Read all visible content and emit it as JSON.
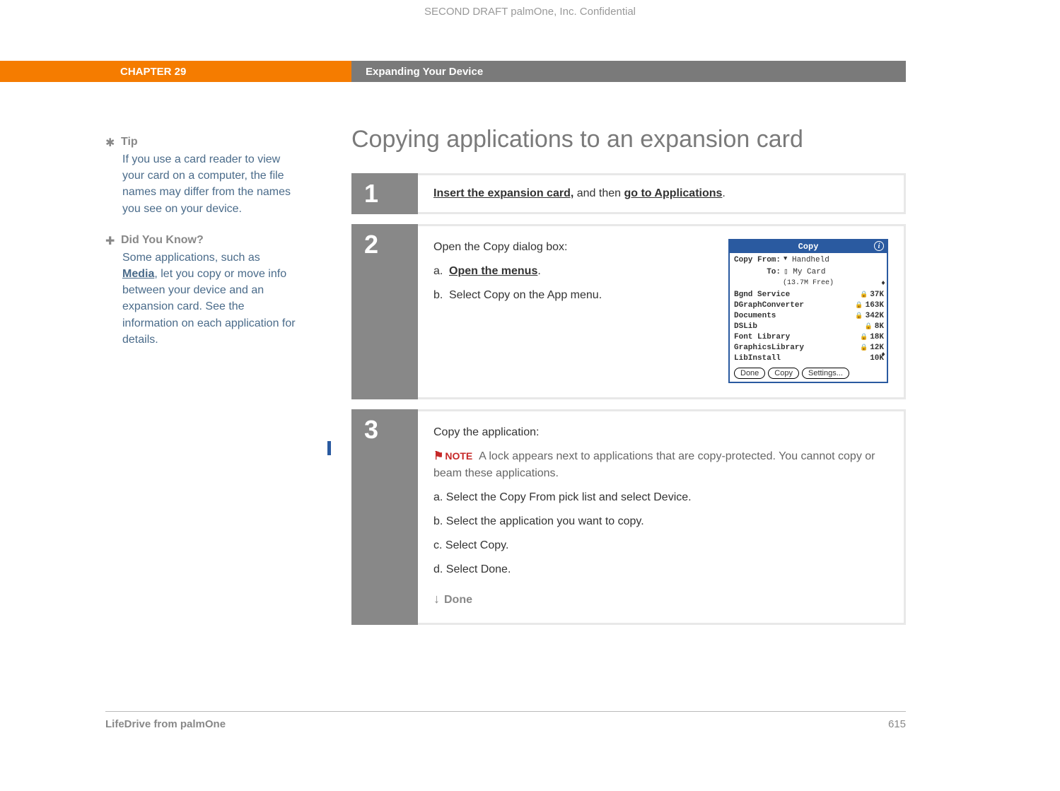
{
  "header": {
    "confidential": "SECOND DRAFT palmOne, Inc.  Confidential",
    "chapter": "CHAPTER 29",
    "chapter_title": "Expanding Your Device"
  },
  "sidebar": {
    "tip": {
      "label": "Tip",
      "body": "If you use a card reader to view your card on a computer, the file names may differ from the names you see on your device."
    },
    "dyk": {
      "label": "Did You Know?",
      "prefix": "Some applications, such as ",
      "link": "Media",
      "suffix": ", let you copy or move info between your device and an expansion card. See the information on each application for details."
    }
  },
  "main": {
    "title": "Copying applications to an expansion card",
    "step1": {
      "num": "1",
      "link1": "Insert the expansion card,",
      "mid": " and then ",
      "link2": "go to Applications",
      "end": "."
    },
    "step2": {
      "num": "2",
      "intro": "Open the Copy dialog box:",
      "a_letter": "a.",
      "a_link": "Open the menus",
      "a_end": ".",
      "b_letter": "b.",
      "b_text": "Select Copy on the App menu."
    },
    "step3": {
      "num": "3",
      "intro": "Copy the application:",
      "note_label": "NOTE",
      "note_text": "A lock appears next to applications that are copy-protected. You cannot copy or beam these applications.",
      "a": "a.  Select the Copy From pick list and select Device.",
      "b": "b.  Select the application you want to copy.",
      "c": "c.  Select Copy.",
      "d": "d.  Select Done.",
      "done": "Done"
    }
  },
  "palm": {
    "title": "Copy",
    "from_label": "Copy From:",
    "from_value": "Handheld",
    "to_label": "To:",
    "to_value": "My Card",
    "free": "(13.7M Free)",
    "items": [
      {
        "name": "Bgnd Service",
        "locked": true,
        "size": "37K"
      },
      {
        "name": "DGraphConverter",
        "locked": true,
        "size": "163K"
      },
      {
        "name": "Documents",
        "locked": true,
        "size": "342K"
      },
      {
        "name": "DSLib",
        "locked": true,
        "size": "8K"
      },
      {
        "name": "Font Library",
        "locked": true,
        "size": "18K"
      },
      {
        "name": "GraphicsLibrary",
        "locked": true,
        "size": "12K"
      },
      {
        "name": "LibInstall",
        "locked": false,
        "size": "10K"
      }
    ],
    "btn_done": "Done",
    "btn_copy": "Copy",
    "btn_settings": "Settings..."
  },
  "footer": {
    "left": "LifeDrive from palmOne",
    "right": "615"
  }
}
